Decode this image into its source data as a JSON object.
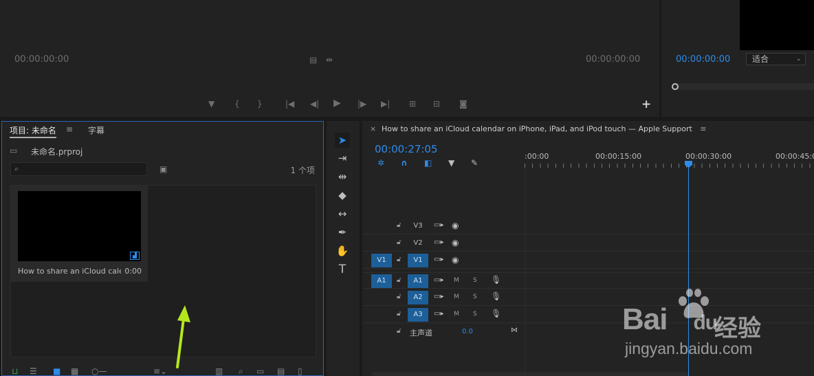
{
  "source_monitor": {
    "timecode_left": "00:00:00:00",
    "timecode_right": "00:00:00:00",
    "controls": [
      "add-marker-icon",
      "mark-in-icon",
      "mark-out-icon",
      "go-to-in-icon",
      "step-back-icon",
      "play-icon",
      "step-forward-icon",
      "go-to-out-icon",
      "insert-icon",
      "overwrite-icon",
      "export-frame-icon"
    ],
    "add_button": "+"
  },
  "program_monitor": {
    "timecode": "00:00:00:00",
    "fit_select": "适合",
    "scrub_position": 0
  },
  "project_panel": {
    "tab_project": "项目: 未命名",
    "tab_captions": "字幕",
    "menu_glyph": "≡",
    "project_file": "未命名.prproj",
    "search_placeholder": "",
    "item_count": "1 个项",
    "clip": {
      "name": "How to share an iCloud cale...",
      "duration": "0:00"
    }
  },
  "tools": [
    "selection-tool-icon",
    "track-select-icon",
    "ripple-edit-icon",
    "razor-icon",
    "slip-icon",
    "pen-icon",
    "hand-icon",
    "type-icon"
  ],
  "timeline": {
    "sequence_title": "How to share an iCloud calendar on iPhone, iPad, and iPod touch — Apple Support",
    "menu_glyph": "≡",
    "close_glyph": "×",
    "timecode": "00:00:27:05",
    "ruler_labels": [
      ":00:00",
      "00:00:15:00",
      "00:00:30:00",
      "00:00:45:00"
    ],
    "playhead_time": "00:00:27:05",
    "video_tracks": [
      {
        "name": "V3",
        "targeted": false,
        "source": ""
      },
      {
        "name": "V2",
        "targeted": false,
        "source": ""
      },
      {
        "name": "V1",
        "targeted": true,
        "source": "V1"
      }
    ],
    "audio_tracks": [
      {
        "name": "A1",
        "source": "A1",
        "m": "M",
        "s": "S"
      },
      {
        "name": "A2",
        "source": "",
        "m": "M",
        "s": "S"
      },
      {
        "name": "A3",
        "source": "",
        "m": "M",
        "s": "S"
      }
    ],
    "master": {
      "label": "主声道",
      "value": "0.0"
    }
  },
  "watermark": {
    "brand": "Bai",
    "brand_suffix": "du",
    "brand_cn": "经验",
    "site": "jingyan.baidu.com"
  },
  "colors": {
    "accent": "#2d8ceb",
    "target_blue": "#1d5f98",
    "arrow": "#b5e61d"
  }
}
